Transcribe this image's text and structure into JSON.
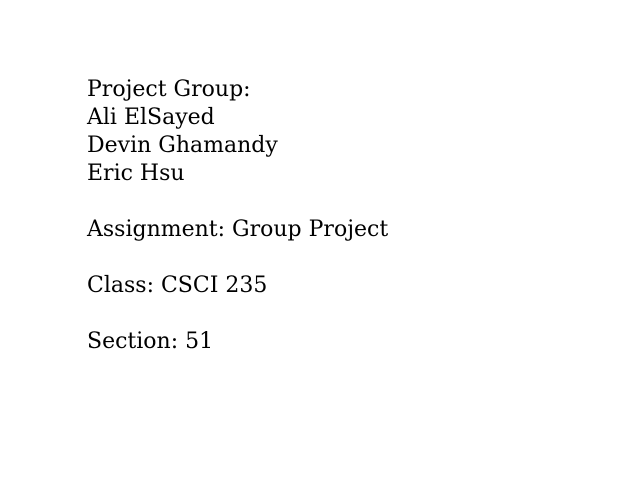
{
  "document": {
    "project_group_heading": "Project Group:",
    "members": [
      "Ali ElSayed",
      "Devin Ghamandy",
      "Eric Hsu"
    ],
    "assignment": "Assignment: Group Project",
    "class": "Class: CSCI 235",
    "section": "Section: 51"
  }
}
